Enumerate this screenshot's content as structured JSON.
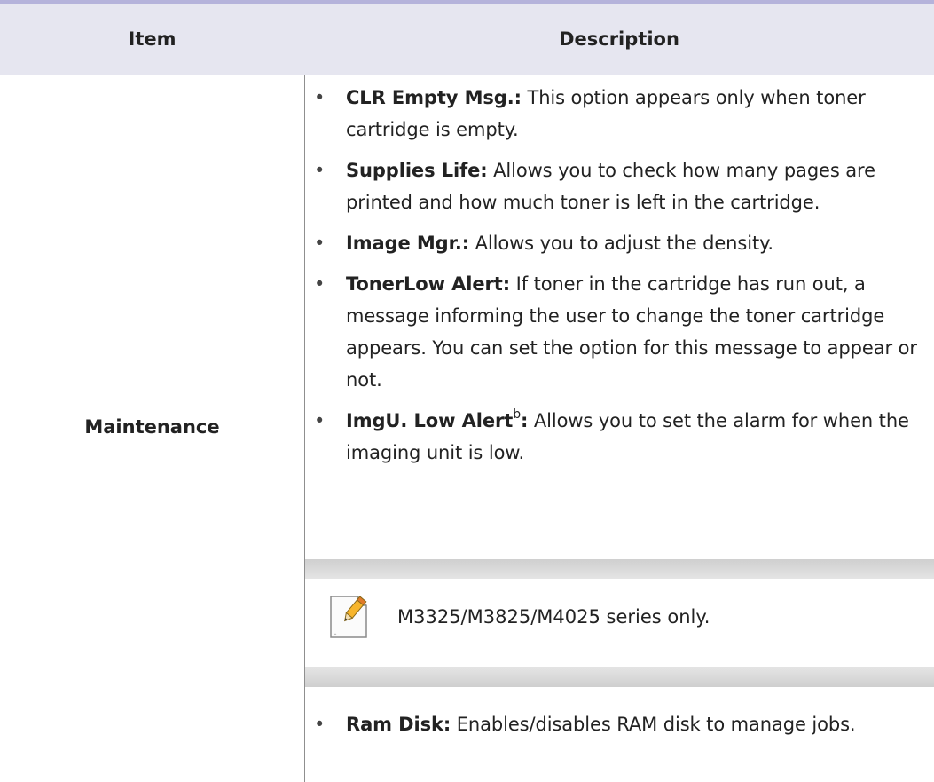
{
  "table": {
    "headers": {
      "item": "Item",
      "description": "Description"
    },
    "row": {
      "item": "Maintenance",
      "bullets": [
        {
          "term": "CLR Empty Msg.:",
          "text": " This option appears only when toner cartridge is empty."
        },
        {
          "term": "Supplies Life:",
          "text": "Allows you to check how many pages are printed and how much toner is left in the cartridge."
        },
        {
          "term": "Image Mgr.:",
          "text": "Allows you to adjust the density."
        },
        {
          "term": "TonerLow Alert:",
          "text": "If toner in the cartridge has run out, a message informing the user to change the toner cartridge appears. You can set the option for this message to appear or not."
        },
        {
          "term": "ImgU. Low Alert",
          "sup": "b",
          "term_suffix": ":",
          "text": "Allows you to set the alarm for when the imaging unit is low."
        }
      ],
      "note": {
        "icon": "note-pencil-icon",
        "text": "M3325/M3825/M4025 series only."
      },
      "last_bullet": {
        "term": "Ram Disk:",
        "text": "Enables/disables RAM disk to manage jobs."
      }
    }
  },
  "colors": {
    "top_rule": "#b5b3db",
    "header_bg": "#e6e6f0",
    "note_band": "#cfcfcf"
  }
}
